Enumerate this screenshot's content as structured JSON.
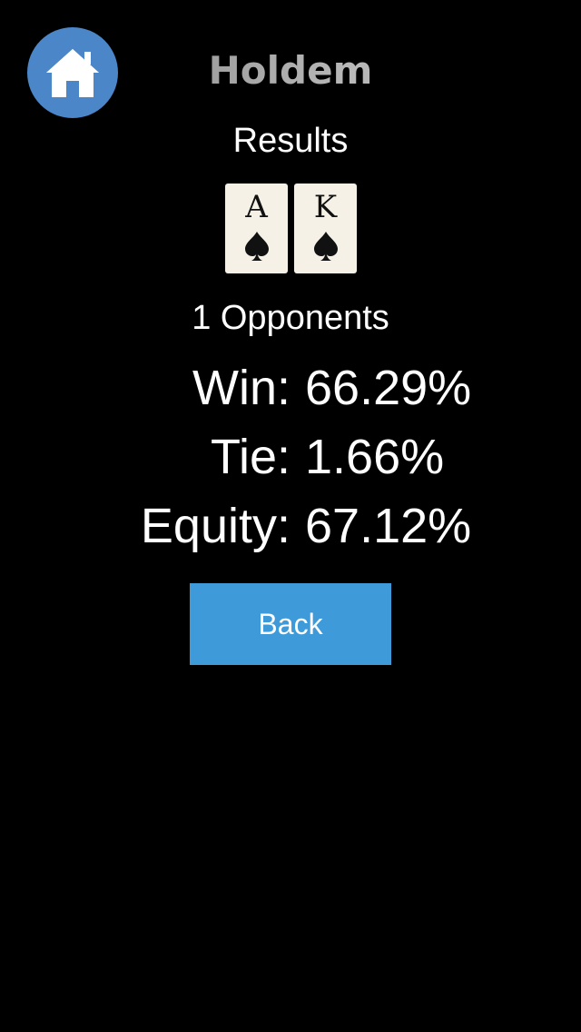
{
  "header": {
    "home_icon": "home-icon",
    "title": "Holdem"
  },
  "results": {
    "heading": "Results"
  },
  "hand": {
    "cards": [
      {
        "rank": "A",
        "suit": "spade",
        "suit_glyph": "♠"
      },
      {
        "rank": "K",
        "suit": "spade",
        "suit_glyph": "♠"
      }
    ]
  },
  "opponents_label": "1 Opponents",
  "stats": {
    "win_label": "Win:",
    "win_value": "66.29%",
    "tie_label": "Tie:",
    "tie_value": "1.66%",
    "equity_label": "Equity:",
    "equity_value": "67.12%"
  },
  "back_label": "Back",
  "colors": {
    "background": "#000000",
    "home_button": "#4a86c8",
    "back_button": "#3e9ad9",
    "card_face": "#f5f1e6"
  }
}
